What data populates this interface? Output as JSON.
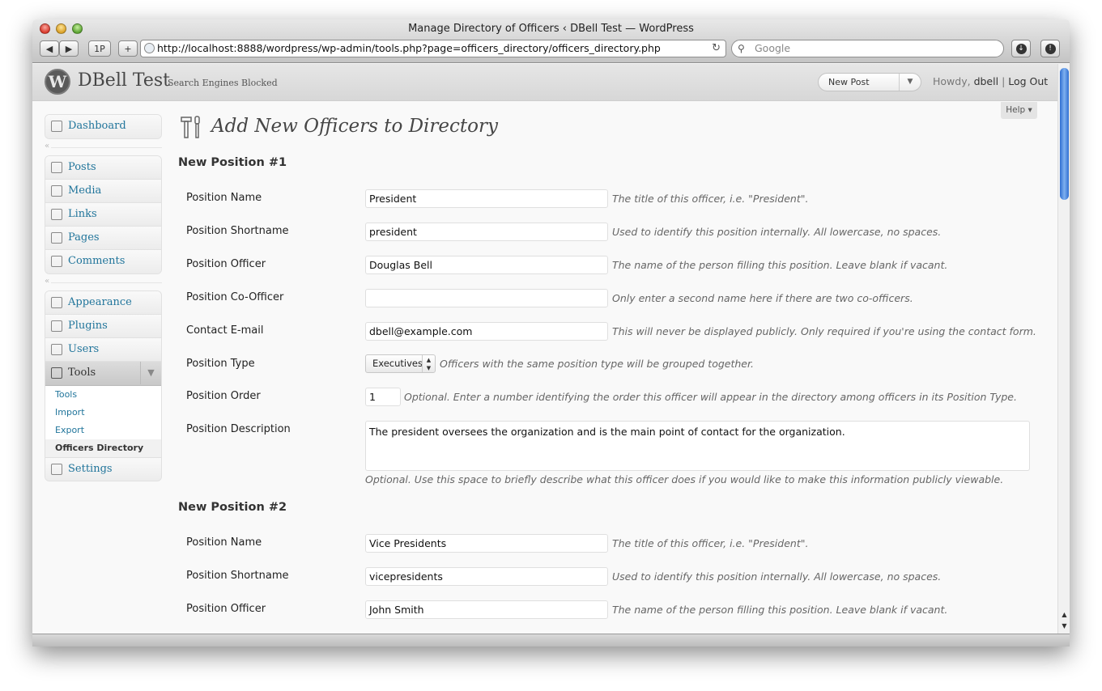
{
  "browser": {
    "window_title": "Manage Directory of Officers ‹ DBell Test — WordPress",
    "back_label": "◀",
    "forward_label": "▶",
    "onepassword_label": "1P",
    "add_label": "+",
    "url": "http://localhost:8888/wordpress/wp-admin/tools.php?page=officers_directory/officers_directory.php",
    "search_placeholder": "Google"
  },
  "header": {
    "site_title": "DBell Test",
    "site_tagline": "Search Engines Blocked",
    "new_post_label": "New Post",
    "howdy_prefix": "Howdy,",
    "username": "dbell",
    "logout_label": "Log Out",
    "help_label": "Help"
  },
  "sidebar": {
    "dashboard": "Dashboard",
    "group1": [
      "Posts",
      "Media",
      "Links",
      "Pages",
      "Comments"
    ],
    "group2": [
      "Appearance",
      "Plugins",
      "Users"
    ],
    "tools_label": "Tools",
    "tools_sub": [
      "Tools",
      "Import",
      "Export",
      "Officers Directory"
    ],
    "settings": "Settings"
  },
  "page": {
    "title": "Add New Officers to Directory",
    "positions": [
      {
        "heading": "New Position #1",
        "name_label": "Position Name",
        "name_value": "President",
        "name_hint": "The title of this officer, i.e. \"President\".",
        "short_label": "Position Shortname",
        "short_value": "president",
        "short_hint": "Used to identify this position internally. All lowercase, no spaces.",
        "officer_label": "Position Officer",
        "officer_value": "Douglas Bell",
        "officer_hint": "The name of the person filling this position. Leave blank if vacant.",
        "coofficer_label": "Position Co-Officer",
        "coofficer_value": "",
        "coofficer_hint": "Only enter a second name here if there are two co-officers.",
        "email_label": "Contact E-mail",
        "email_value": "dbell@example.com",
        "email_hint": "This will never be displayed publicly. Only required if you're using the contact form.",
        "type_label": "Position Type",
        "type_value": "Executives",
        "type_hint": "Officers with the same position type will be grouped together.",
        "order_label": "Position Order",
        "order_value": "1",
        "order_hint": "Optional. Enter a number identifying the order this officer will appear in the directory among officers in its Position Type.",
        "desc_label": "Position Description",
        "desc_value": "The president oversees the organization and is the main point of contact for the organization.",
        "desc_hint": "Optional. Use this space to briefly describe what this officer does if you would like to make this information publicly viewable."
      },
      {
        "heading": "New Position #2",
        "name_label": "Position Name",
        "name_value": "Vice Presidents",
        "name_hint": "The title of this officer, i.e. \"President\".",
        "short_label": "Position Shortname",
        "short_value": "vicepresidents",
        "short_hint": "Used to identify this position internally. All lowercase, no spaces.",
        "officer_label": "Position Officer",
        "officer_value": "John Smith",
        "officer_hint": "The name of the person filling this position. Leave blank if vacant."
      }
    ]
  },
  "colors": {
    "link": "#21759b",
    "scroll_thumb": "#3b7bd8"
  }
}
